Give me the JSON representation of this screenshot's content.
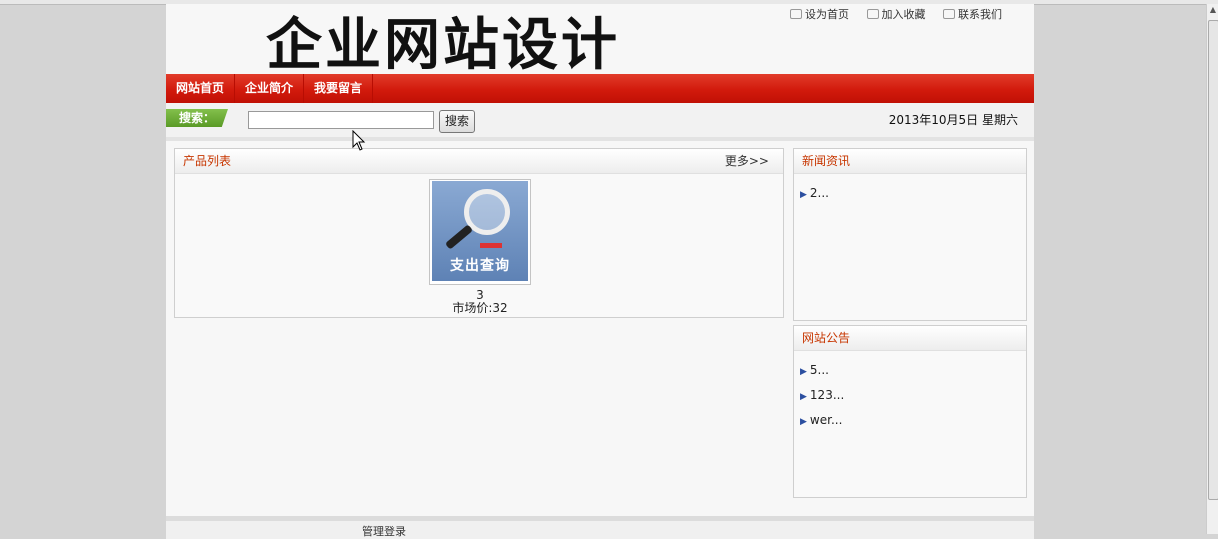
{
  "header": {
    "site_title": "企业网站设计",
    "top_links": [
      "设为首页",
      "加入收藏",
      "联系我们"
    ]
  },
  "nav": [
    "网站首页",
    "企业简介",
    "我要留言"
  ],
  "search": {
    "label": "搜索：",
    "value": "",
    "placeholder": "",
    "button": "搜索"
  },
  "date_text": "2013年10月5日  星期六",
  "products": {
    "title": "产品列表",
    "more": "更多>>",
    "items": [
      {
        "name": "3",
        "price": "市场价:32",
        "image_text": "支出查询"
      }
    ]
  },
  "news": {
    "title": "新闻资讯",
    "items": [
      "2..."
    ]
  },
  "notice": {
    "title": "网站公告",
    "items": [
      "5...",
      "123...",
      "wer..."
    ]
  },
  "footer": {
    "text": "管理登录"
  },
  "colors": {
    "nav_red": "#d21a0c",
    "search_green": "#6aa834",
    "box_title": "#c73600"
  }
}
